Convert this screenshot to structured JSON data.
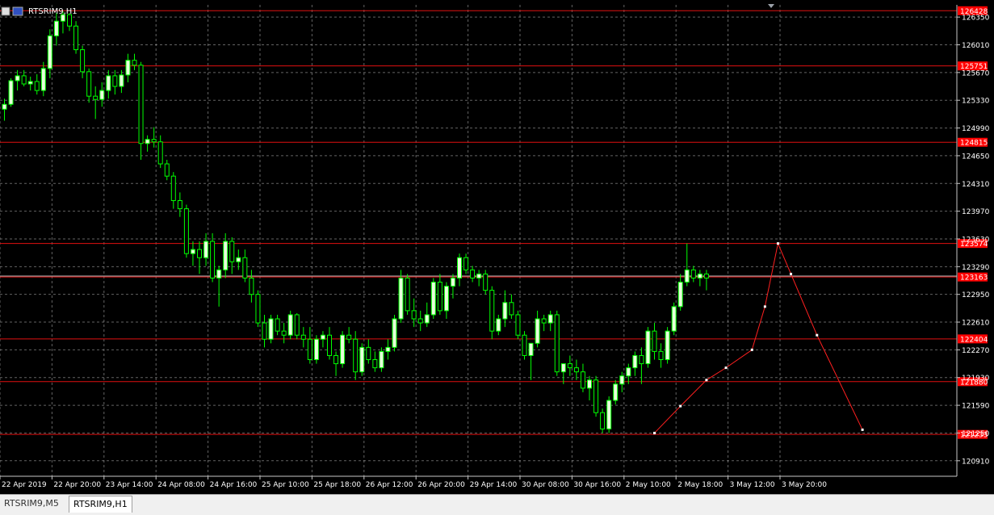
{
  "window": {
    "title": "RTSRIM9,H1"
  },
  "tabs": [
    {
      "label": "RTSRIM9,M5",
      "active": false
    },
    {
      "label": "RTSRIM9,H1",
      "active": true
    }
  ],
  "colors": {
    "background": "#000000",
    "grid": "#b4b4b4",
    "axis": "#c8c8c8",
    "bull_body": "#e8ffdc",
    "bear_body": "#000000",
    "wick": "#00ff00",
    "level_line": "#e01010",
    "level_label_bg": "#ff0000",
    "zigzag": "#ff2020",
    "bid_line": "#c0c0c0"
  },
  "chart_data": {
    "type": "candlestick",
    "symbol": "RTSRIM9",
    "timeframe": "H1",
    "price_scale": {
      "ticks": [
        126350,
        126010,
        125670,
        125330,
        124990,
        124650,
        124310,
        123970,
        123630,
        123290,
        122950,
        122610,
        122270,
        121930,
        121590,
        121250,
        120910
      ],
      "ylim": [
        120720,
        126500
      ]
    },
    "time_labels": [
      "22 Apr 2019",
      "22 Apr 20:00",
      "23 Apr 14:00",
      "24 Apr 08:00",
      "24 Apr 16:00",
      "25 Apr 10:00",
      "25 Apr 18:00",
      "26 Apr 12:00",
      "26 Apr 20:00",
      "29 Apr 14:00",
      "30 Apr 08:00",
      "30 Apr 16:00",
      "2 May 10:00",
      "2 May 18:00",
      "3 May 12:00",
      "3 May 20:00"
    ],
    "levels": [
      {
        "price": 126428,
        "label": "126428"
      },
      {
        "price": 125751,
        "label": "125751"
      },
      {
        "price": 124815,
        "label": "124815"
      },
      {
        "price": 123574,
        "label": "123574"
      },
      {
        "price": 123163,
        "label": "123163"
      },
      {
        "price": 122404,
        "label": "122404"
      },
      {
        "price": 121880,
        "label": "121880"
      },
      {
        "price": 121233,
        "label": "121233"
      }
    ],
    "bid_price": 123175,
    "zigzag": [
      {
        "bar": 100,
        "price": 121250
      },
      {
        "bar": 104,
        "price": 121580
      },
      {
        "bar": 108,
        "price": 121900
      },
      {
        "bar": 111,
        "price": 122050
      },
      {
        "bar": 115,
        "price": 122270
      },
      {
        "bar": 117,
        "price": 122800
      },
      {
        "bar": 119,
        "price": 123574
      },
      {
        "bar": 121,
        "price": 123200
      },
      {
        "bar": 125,
        "price": 122450
      },
      {
        "bar": 132,
        "price": 121290
      }
    ],
    "candles": [
      [
        125220,
        125350,
        125080,
        125280
      ],
      [
        125280,
        125600,
        125250,
        125570
      ],
      [
        125570,
        125700,
        125450,
        125630
      ],
      [
        125630,
        125700,
        125500,
        125530
      ],
      [
        125530,
        125620,
        125450,
        125560
      ],
      [
        125560,
        125650,
        125400,
        125450
      ],
      [
        125450,
        125800,
        125380,
        125720
      ],
      [
        125720,
        126200,
        125600,
        126120
      ],
      [
        126120,
        126400,
        126000,
        126300
      ],
      [
        126300,
        126420,
        126150,
        126380
      ],
      [
        126380,
        126400,
        126180,
        126240
      ],
      [
        126240,
        126300,
        125900,
        125950
      ],
      [
        125950,
        126000,
        125600,
        125680
      ],
      [
        125680,
        125720,
        125300,
        125380
      ],
      [
        125380,
        125500,
        125100,
        125340
      ],
      [
        125340,
        125550,
        125250,
        125450
      ],
      [
        125450,
        125700,
        125350,
        125630
      ],
      [
        125630,
        125700,
        125400,
        125500
      ],
      [
        125500,
        125700,
        125420,
        125640
      ],
      [
        125640,
        125900,
        125550,
        125820
      ],
      [
        125820,
        125900,
        125700,
        125760
      ],
      [
        125760,
        125800,
        124600,
        124800
      ],
      [
        124800,
        124900,
        124700,
        124850
      ],
      [
        124850,
        125000,
        124750,
        124820
      ],
      [
        124820,
        124900,
        124500,
        124550
      ],
      [
        124550,
        124600,
        124350,
        124400
      ],
      [
        124400,
        124450,
        124000,
        124100
      ],
      [
        124100,
        124200,
        123900,
        124000
      ],
      [
        124000,
        124050,
        123400,
        123450
      ],
      [
        123450,
        123600,
        123300,
        123500
      ],
      [
        123500,
        123600,
        123200,
        123400
      ],
      [
        123400,
        123700,
        123300,
        123600
      ],
      [
        123600,
        123700,
        123100,
        123150
      ],
      [
        123150,
        123300,
        122800,
        123250
      ],
      [
        123250,
        123700,
        123150,
        123600
      ],
      [
        123600,
        123650,
        123200,
        123350
      ],
      [
        123350,
        123500,
        123250,
        123400
      ],
      [
        123400,
        123500,
        123100,
        123150
      ],
      [
        123150,
        123250,
        122850,
        122950
      ],
      [
        122950,
        123000,
        122550,
        122600
      ],
      [
        122600,
        122700,
        122300,
        122400
      ],
      [
        122400,
        122700,
        122350,
        122650
      ],
      [
        122650,
        122700,
        122450,
        122500
      ],
      [
        122500,
        122600,
        122350,
        122450
      ],
      [
        122450,
        122750,
        122400,
        122700
      ],
      [
        122700,
        122720,
        122400,
        122450
      ],
      [
        122450,
        122550,
        122300,
        122400
      ],
      [
        122400,
        122550,
        122100,
        122150
      ],
      [
        122150,
        122450,
        122100,
        122400
      ],
      [
        122400,
        122500,
        122300,
        122450
      ],
      [
        122450,
        122550,
        122150,
        122200
      ],
      [
        122200,
        122250,
        121950,
        122100
      ],
      [
        122100,
        122500,
        122050,
        122450
      ],
      [
        122450,
        122550,
        122350,
        122400
      ],
      [
        122400,
        122500,
        121900,
        122000
      ],
      [
        122000,
        122350,
        121950,
        122300
      ],
      [
        122300,
        122400,
        122100,
        122150
      ],
      [
        122150,
        122250,
        122000,
        122050
      ],
      [
        122050,
        122300,
        122000,
        122250
      ],
      [
        122250,
        122400,
        122150,
        122300
      ],
      [
        122300,
        122700,
        122250,
        122650
      ],
      [
        122650,
        123250,
        122600,
        123150
      ],
      [
        123150,
        123200,
        122700,
        122750
      ],
      [
        122750,
        122900,
        122550,
        122650
      ],
      [
        122650,
        122750,
        122500,
        122600
      ],
      [
        122600,
        122850,
        122550,
        122700
      ],
      [
        122700,
        123150,
        122650,
        123100
      ],
      [
        123100,
        123200,
        122700,
        122750
      ],
      [
        122750,
        123100,
        122650,
        123050
      ],
      [
        123050,
        123200,
        122900,
        123150
      ],
      [
        123150,
        123450,
        123050,
        123400
      ],
      [
        123400,
        123450,
        123200,
        123250
      ],
      [
        123250,
        123300,
        123100,
        123150
      ],
      [
        123150,
        123250,
        123050,
        123200
      ],
      [
        123200,
        123250,
        122950,
        123000
      ],
      [
        123000,
        123050,
        122400,
        122500
      ],
      [
        122500,
        122700,
        122450,
        122650
      ],
      [
        122650,
        123000,
        122550,
        122850
      ],
      [
        122850,
        122950,
        122650,
        122700
      ],
      [
        122700,
        122750,
        122400,
        122450
      ],
      [
        122450,
        122500,
        122150,
        122200
      ],
      [
        122200,
        122300,
        121900,
        122350
      ],
      [
        122350,
        122750,
        122300,
        122650
      ],
      [
        122650,
        122700,
        122500,
        122600
      ],
      [
        122600,
        122750,
        122500,
        122700
      ],
      [
        122700,
        122750,
        121950,
        122000
      ],
      [
        122000,
        122100,
        121850,
        122100
      ],
      [
        122100,
        122200,
        121950,
        122050
      ],
      [
        122050,
        122150,
        121900,
        122000
      ],
      [
        122000,
        122100,
        121750,
        121800
      ],
      [
        121800,
        121950,
        121650,
        121900
      ],
      [
        121900,
        121950,
        121450,
        121500
      ],
      [
        121500,
        121550,
        121250,
        121300
      ],
      [
        121300,
        121700,
        121250,
        121650
      ],
      [
        121650,
        121900,
        121600,
        121850
      ],
      [
        121850,
        122000,
        121750,
        121950
      ],
      [
        121950,
        122100,
        121850,
        122050
      ],
      [
        122050,
        122250,
        121950,
        122200
      ],
      [
        122200,
        122300,
        121850,
        122100
      ],
      [
        122100,
        122550,
        122050,
        122500
      ],
      [
        122500,
        122600,
        122150,
        122250
      ],
      [
        122250,
        122350,
        122050,
        122150
      ],
      [
        122150,
        122550,
        122100,
        122500
      ],
      [
        122500,
        122850,
        122450,
        122800
      ],
      [
        122800,
        123200,
        122750,
        123100
      ],
      [
        123100,
        123574,
        123050,
        123250
      ],
      [
        123250,
        123300,
        123100,
        123150
      ],
      [
        123150,
        123250,
        123050,
        123200
      ],
      [
        123200,
        123250,
        123000,
        123150
      ]
    ]
  }
}
